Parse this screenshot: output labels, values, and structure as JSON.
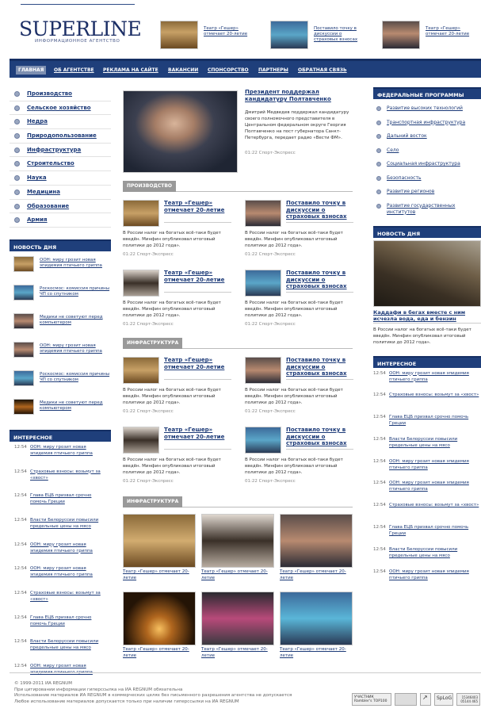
{
  "header": {
    "logo_main": "SUPERLINE",
    "logo_sub": "ИНФОРМАЦИОННОЕ АГЕНТСТВО",
    "news": [
      {
        "title": "Театр «Гешер» отмечает 20-летие"
      },
      {
        "title": "Поставило точку в дискуссии о страховых взносах"
      },
      {
        "title": "Театр «Гешер» отмечает 20-летие"
      }
    ]
  },
  "nav": {
    "items": [
      "ГЛАВНАЯ",
      "ОБ АГЕНТСТВЕ",
      "РЕКЛАМА НА САЙТЕ",
      "ВАКАНСИИ",
      "СПОНСОРСТВО",
      "ПАРТНЕРЫ",
      "ОБРАТНАЯ СВЯЗЬ"
    ]
  },
  "left": {
    "categories": [
      "Производство",
      "Сельское хозяйство",
      "Недра",
      "Природопользование",
      "Инфраструктура",
      "Строительство",
      "Наука",
      "Медицина",
      "Образование",
      "Армия"
    ],
    "day_title": "НОВОСТЬ ДНЯ",
    "day_news": [
      "ООН: миру грозит новая эпидемия птичьего гриппа",
      "Роскосмос: комиссия причины ЧП со спутником",
      "Медики не советуют перед компьютером",
      "ООН: миру грозит новая эпидемия птичьего гриппа",
      "Роскосмос: комиссия причины ЧП со спутником",
      "Медики не советуют перед компьютером"
    ],
    "int_title": "ИНТЕРЕСНОЕ",
    "interesting": [
      {
        "time": "12:54",
        "text": "ООН: миру грозит новая эпидемия птичьего гриппа"
      },
      {
        "time": "12:54",
        "text": "Страховые взносы: возьмут за «хвост»"
      },
      {
        "time": "12:54",
        "text": "Глава ЕЦБ призвал срочно помочь Греции"
      },
      {
        "time": "12:54",
        "text": "Власти Белоруссии повысили предельные цены на мясо"
      },
      {
        "time": "12:54",
        "text": "ООН: миру грозит новая эпидемия птичьего гриппа"
      },
      {
        "time": "12:54",
        "text": "ООН: миру грозит новая эпидемия птичьего гриппа"
      },
      {
        "time": "12:54",
        "text": "Страховые взносы: возьмут за «хвост»"
      },
      {
        "time": "12:54",
        "text": "Глава ЕЦБ призвал срочно помочь Греции"
      },
      {
        "time": "12:54",
        "text": "Власти Белоруссии повысили предельные цены на мясо"
      },
      {
        "time": "12:54",
        "text": "ООН: миру грозит новая эпидемия птичьего гриппа"
      }
    ]
  },
  "center": {
    "lead": {
      "title": "Президент поддержал кандидатуру Полтавченко",
      "desc": "Дмитрий Медведев поддержал кандидатуру своего полномочного представителя в Центральном федеральном округе Георгия Полтавченко на пост губернатора Санкт-Петербурга, передает радио «Вести ФМ».",
      "time": "01:22 Спорт-Экспресс"
    },
    "sec1": "ПРОИЗВОДСТВО",
    "sec2": "ИНФРАСТРУКТУРА",
    "sec3": "ИНФРАСТРУКТУРА",
    "art_desc": "В России налог на богатых всё-таки будет введён. Минфин опубликовал итоговый политики до 2012 года».",
    "art_time": "01:22 Спорт-Экспресс",
    "t1": "Театр «Гешер» отмечает 20-летие",
    "t2": "Поставило точку в дискуссии о страховых взносах",
    "gallery": "Театр «Гешер» отмечает 20-летие"
  },
  "right": {
    "fed_title": "ФЕДЕРАЛЬНЫЕ ПРОГРАММЫ",
    "fed": [
      "Развитие высоких технологий",
      "Транспортная инфраструктура",
      "Дальний восток",
      "Село",
      "Социальная инфраструктура",
      "Безопасность",
      "Развитие регионов",
      "Развитие государственных институтов"
    ],
    "day_title": "НОВОСТЬ ДНЯ",
    "day_head": "Каддафи в бегах вместе с ним исчезла вода, еда и бензин",
    "day_desc": "В России налог на богатых всё-таки будет введён. Минфин опубликовал итоговый политики до 2012 года».",
    "int_title": "ИНТЕРЕСНОЕ",
    "interesting": [
      {
        "time": "12:54",
        "text": "ООН: миру грозит новая эпидемия птичьего гриппа"
      },
      {
        "time": "12:54",
        "text": "Страховые взносы: возьмут за «хвост»"
      },
      {
        "time": "12:54",
        "text": "Глава ЕЦБ призвал срочно помочь Греции"
      },
      {
        "time": "12:54",
        "text": "Власти Белоруссии повысили предельные цены на мясо"
      },
      {
        "time": "12:54",
        "text": "ООН: миру грозит новая эпидемия птичьего гриппа"
      },
      {
        "time": "12:54",
        "text": "ООН: миру грозит новая эпидемия птичьего гриппа"
      },
      {
        "time": "12:54",
        "text": "Страховые взносы: возьмут за «хвост»"
      },
      {
        "time": "12:54",
        "text": "Глава ЕЦБ призвал срочно помочь Греции"
      },
      {
        "time": "12:54",
        "text": "Власти Белоруссии повысили предельные цены на мясо"
      },
      {
        "time": "12:54",
        "text": "ООН: миру грозит новая эпидемия птичьего гриппа"
      }
    ]
  },
  "footer": {
    "lines": [
      "© 1999-2011 ИА REGNUM",
      "При цитировании информации гиперссылка на ИА REGNUM обязательна",
      "Использование материалов ИА REGNUM в коммерческих целях без письменного разрешения агентства не допускается",
      "Любое использование материалов допускается только при наличии гиперссылки на ИА REGNUM"
    ],
    "badge1": "УЧАСТНИК Rambler's TOP100",
    "badge2": "SpLoG",
    "counter": "15346403 05144 465"
  }
}
